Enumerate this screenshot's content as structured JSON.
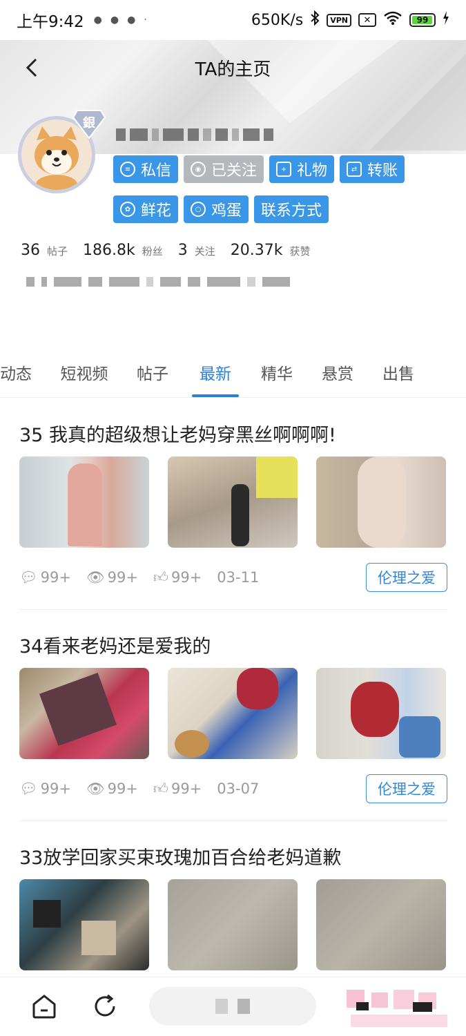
{
  "status_bar": {
    "time": "上午9:42",
    "speed": "650K/s",
    "vpn": "VPN",
    "battery": "99",
    "battery_color": "#5ad53a"
  },
  "nav": {
    "title": "TA的主页",
    "back_icon": "chevron-left-icon"
  },
  "profile": {
    "level_badge": "銀",
    "actions_row1": [
      "私信",
      "已关注",
      "礼物",
      "转账"
    ],
    "actions_row2": [
      "鲜花",
      "鸡蛋",
      "联系方式"
    ],
    "stats": [
      {
        "value": "36",
        "label": "帖子"
      },
      {
        "value": "186.8k",
        "label": "粉丝"
      },
      {
        "value": "3",
        "label": "关注"
      },
      {
        "value": "20.37k",
        "label": "获赞"
      }
    ]
  },
  "tabs": [
    "动态",
    "短视频",
    "帖子",
    "最新",
    "精华",
    "悬赏",
    "出售"
  ],
  "active_tab": "最新",
  "accent_color": "#2c80d4",
  "posts": [
    {
      "title": "35 我真的超级想让老妈穿黑丝啊啊啊!",
      "comments": "99+",
      "views": "99+",
      "likes": "99+",
      "date": "03-11",
      "tag": "伦理之爱"
    },
    {
      "title": "34看来老妈还是爱我的",
      "comments": "99+",
      "views": "99+",
      "likes": "99+",
      "date": "03-07",
      "tag": "伦理之爱"
    },
    {
      "title": " 33放学回家买束玫瑰加百合给老妈道歉"
    }
  ]
}
